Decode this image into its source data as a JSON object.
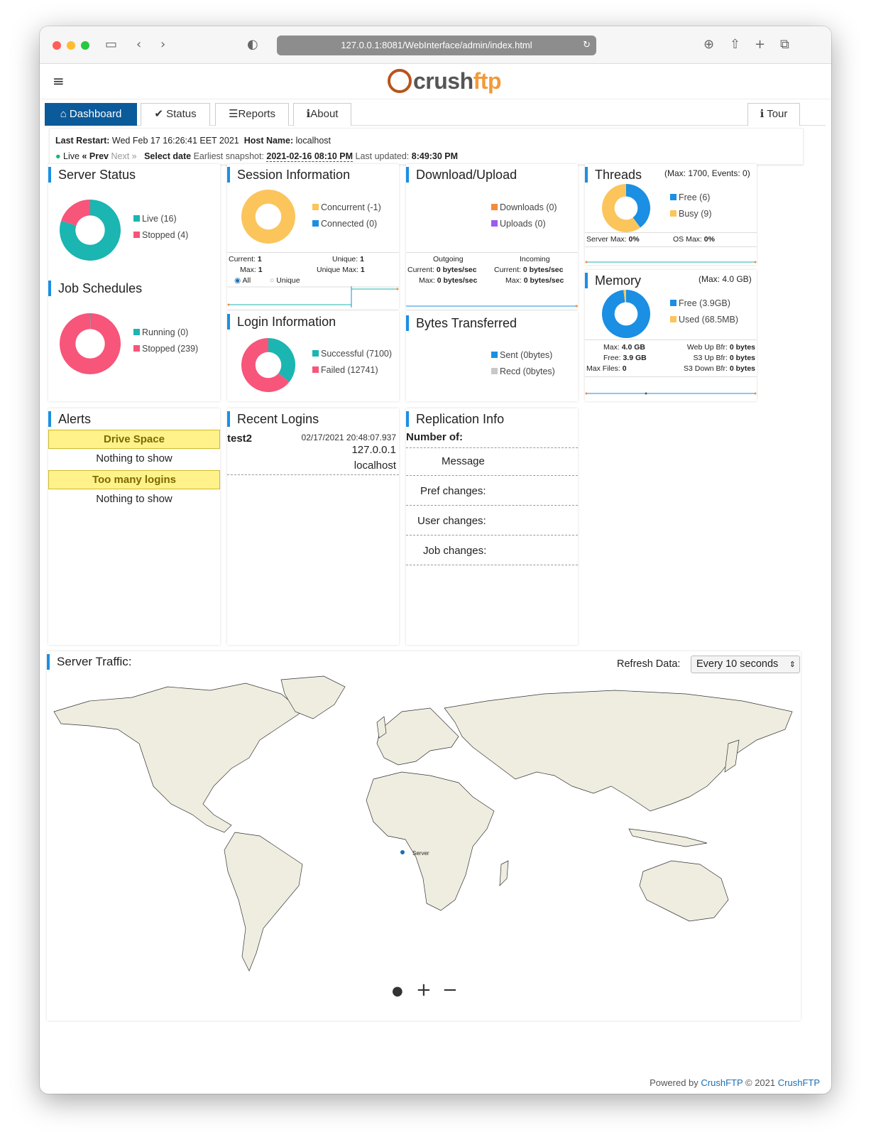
{
  "browser": {
    "url": "127.0.0.1:8081/WebInterface/admin/index.html"
  },
  "logo": {
    "part1": "crush",
    "part2": "ftp"
  },
  "tabs": [
    {
      "label": "Dashboard",
      "icon": "home-icon"
    },
    {
      "label": "Status",
      "icon": "check-icon"
    },
    {
      "label": "Reports",
      "icon": "list-icon"
    },
    {
      "label": "About",
      "icon": "info-icon"
    }
  ],
  "tour_label": "Tour",
  "info": {
    "last_restart_label": "Last Restart:",
    "last_restart": "Wed Feb 17 16:26:41 EET 2021",
    "host_name_label": "Host Name:",
    "host_name": "localhost",
    "live": "Live",
    "prev": "Prev",
    "next": "Next",
    "select_date": "Select date",
    "earliest_label": "Earliest snapshot:",
    "earliest": "2021-02-16 08:10 PM",
    "updated_label": "Last updated:",
    "updated": "8:49:30 PM"
  },
  "server_status": {
    "title": "Server Status",
    "legend": [
      {
        "label": "Live (16)",
        "color": "#1bb5b2"
      },
      {
        "label": "Stopped (4)",
        "color": "#f7557a"
      }
    ]
  },
  "job_schedules": {
    "title": "Job Schedules",
    "legend": [
      {
        "label": "Running (0)",
        "color": "#1bb5b2"
      },
      {
        "label": "Stopped (239)",
        "color": "#f7557a"
      }
    ]
  },
  "session": {
    "title": "Session Information",
    "legend": [
      {
        "label": "Concurrent (-1)",
        "color": "#fbc55c"
      },
      {
        "label": "Connected (0)",
        "color": "#1a8fe3"
      }
    ],
    "current_label": "Current:",
    "current": "1",
    "unique_label": "Unique:",
    "unique": "1",
    "max_label": "Max:",
    "max": "1",
    "unique_max_label": "Unique Max:",
    "unique_max": "1",
    "radio_all": "All",
    "radio_unique": "Unique"
  },
  "login": {
    "title": "Login Information",
    "legend": [
      {
        "label": "Successful (7100)",
        "color": "#1bb5b2"
      },
      {
        "label": "Failed (12741)",
        "color": "#f7557a"
      }
    ]
  },
  "download": {
    "title": "Download/Upload",
    "legend": [
      {
        "label": "Downloads (0)",
        "color": "#f58a3c"
      },
      {
        "label": "Uploads (0)",
        "color": "#9a5cf0"
      }
    ],
    "outgoing": "Outgoing",
    "incoming": "Incoming",
    "current_label": "Current:",
    "max_label": "Max:",
    "out_current": "0 bytes/sec",
    "out_max": "0 bytes/sec",
    "in_current": "0 bytes/sec",
    "in_max": "0 bytes/sec"
  },
  "bytes": {
    "title": "Bytes Transferred",
    "legend": [
      {
        "label": "Sent (0bytes)",
        "color": "#1a8fe3"
      },
      {
        "label": "Recd (0bytes)",
        "color": "#c8c8c8"
      }
    ]
  },
  "threads": {
    "title": "Threads",
    "subtitle": "(Max: 1700, Events: 0)",
    "legend": [
      {
        "label": "Free (6)",
        "color": "#1a8fe3"
      },
      {
        "label": "Busy (9)",
        "color": "#fbc55c"
      }
    ],
    "server_max_label": "Server Max:",
    "server_max": "0%",
    "os_max_label": "OS Max:",
    "os_max": "0%"
  },
  "memory": {
    "title": "Memory",
    "subtitle": "(Max: 4.0 GB)",
    "legend": [
      {
        "label": "Free (3.9GB)",
        "color": "#1a8fe3"
      },
      {
        "label": "Used (68.5MB)",
        "color": "#fbc55c"
      }
    ],
    "max_label": "Max:",
    "max": "4.0 GB",
    "free_label": "Free:",
    "free": "3.9 GB",
    "max_files_label": "Max Files:",
    "max_files": "0",
    "web_up_label": "Web Up Bfr:",
    "web_up": "0 bytes",
    "s3_up_label": "S3 Up Bfr:",
    "s3_up": "0 bytes",
    "s3_down_label": "S3 Down Bfr:",
    "s3_down": "0 bytes"
  },
  "alerts": {
    "title": "Alerts",
    "drive_space": "Drive Space",
    "too_many": "Too many logins",
    "nothing": "Nothing to show"
  },
  "recent": {
    "title": "Recent Logins",
    "user": "test2",
    "time": "02/17/2021 20:48:07.937",
    "ip": "127.0.0.1",
    "host": "localhost"
  },
  "replication": {
    "title": "Replication Info",
    "number_of": "Number of:",
    "message": "Message",
    "pref": "Pref changes:",
    "user": "User changes:",
    "job": "Job changes:"
  },
  "traffic": {
    "title": "Server Traffic:",
    "refresh_label": "Refresh Data:",
    "refresh_value": "Every 10 seconds",
    "server_label": "Server"
  },
  "footer": {
    "powered": "Powered by",
    "brand": "CrushFTP",
    "copy": "© 2021",
    "brand2": "CrushFTP"
  }
}
